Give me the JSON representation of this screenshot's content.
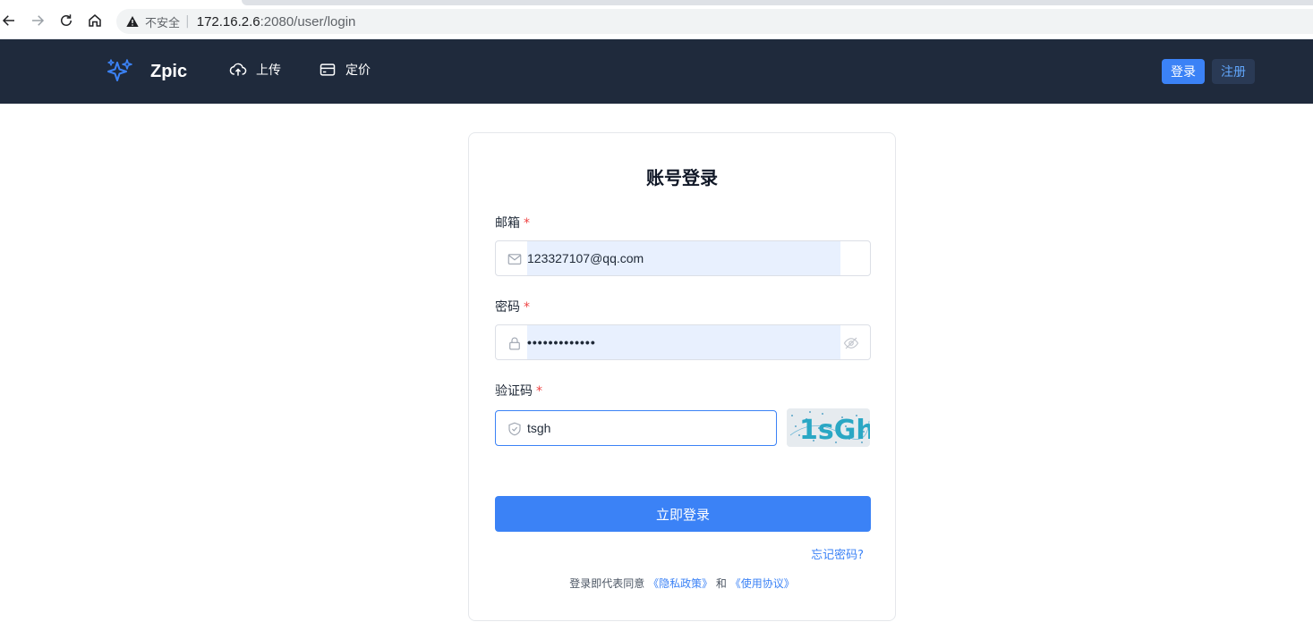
{
  "browser": {
    "insecure_label": "不安全",
    "host": "172.16.2.6",
    "path": ":2080/user/login"
  },
  "header": {
    "brand": "Zpic",
    "nav": [
      {
        "label": "上传",
        "icon": "cloud-upload-icon"
      },
      {
        "label": "定价",
        "icon": "credit-card-icon"
      }
    ],
    "login_label": "登录",
    "register_label": "注册"
  },
  "form": {
    "title": "账号登录",
    "required_mark": "*",
    "email": {
      "label": "邮箱",
      "value": "123327107@qq.com",
      "icon": "mail-icon"
    },
    "password": {
      "label": "密码",
      "value": "•••••••••••••",
      "icon": "lock-icon"
    },
    "captcha": {
      "label": "验证码",
      "value": "tsgh",
      "icon": "shield-icon",
      "image_text": "1sGh"
    },
    "submit_label": "立即登录",
    "forgot_label": "忘记密码?",
    "agree_prefix": "登录即代表同意",
    "privacy_link": "《隐私政策》",
    "and_text": "和",
    "terms_link": "《使用协议》"
  },
  "colors": {
    "header_bg": "#1f2a3c",
    "primary": "#3b82f6",
    "autofill_bg": "#e8f0fe"
  }
}
